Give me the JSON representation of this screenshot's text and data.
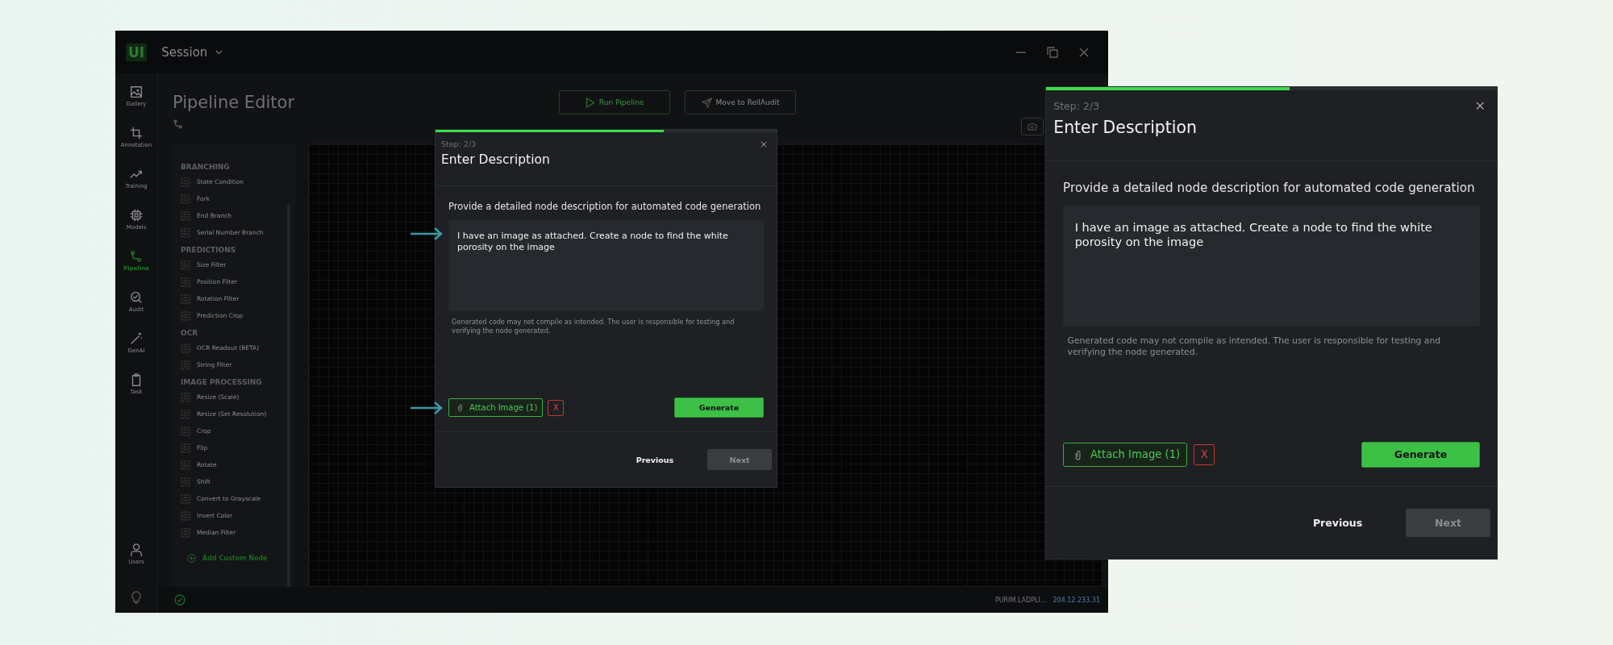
{
  "window": {
    "logo": "UI",
    "title": "Session"
  },
  "nav_rail": [
    {
      "label": "Gallery",
      "selected": false
    },
    {
      "label": "Annotation",
      "selected": false
    },
    {
      "label": "Training",
      "selected": false
    },
    {
      "label": "Models",
      "selected": false
    },
    {
      "label": "Pipeline",
      "selected": true
    },
    {
      "label": "Audit",
      "selected": false
    },
    {
      "label": "GenAI",
      "selected": false
    },
    {
      "label": "Task",
      "selected": false
    }
  ],
  "nav_bottom": {
    "label": "Users"
  },
  "page": {
    "title": "Pipeline Editor"
  },
  "toolbar": {
    "run_button": "Run Pipeline",
    "move_button": "Move to RellAudit"
  },
  "node_library": {
    "groups": [
      {
        "heading": "BRANCHING",
        "items": [
          "State Condition",
          "Fork",
          "End Branch",
          "Serial Number Branch"
        ]
      },
      {
        "heading": "PREDICTIONS",
        "items": [
          "Size Filter",
          "Position Filter",
          "Rotation Filter",
          "Prediction Crop"
        ]
      },
      {
        "heading": "OCR",
        "items": [
          "OCR Readout (BETA)",
          "String Filter"
        ]
      },
      {
        "heading": "IMAGE PROCESSING",
        "items": [
          "Resize (Scale)",
          "Resize (Set Resolution)",
          "Crop",
          "Flip",
          "Rotate",
          "Shift",
          "Convert to Grayscale",
          "Invert Color",
          "Median Filter"
        ]
      }
    ],
    "add_custom_node": "Add Custom Node"
  },
  "status_bar": {
    "user": "PURIM.LADPLI...",
    "ip": "204.12.233.31"
  },
  "dialogs": [
    {
      "step": "Step: 2/3",
      "level": 0.67,
      "title": "Enter Description",
      "prompt": "Provide a detailed node description for automated code generation",
      "description": "I have an image as attached. Create a node to find the white porosity on the image",
      "disclaimer": "Generated code may not compile as intended. The user is responsible for testing and verifying the node generated.",
      "attach_button": "Attach Image (1)",
      "remove_button": "X",
      "generate_button": "Generate",
      "previous_button": "Previous",
      "next_button": "Next",
      "next_disabled": true
    },
    {
      "step": "Step: 2/3",
      "level": 0.54,
      "title": "Enter Description",
      "prompt": "Provide a detailed node description for automated code generation",
      "description": "I have an image as attached. Create a node to find the white porosity on the image",
      "disclaimer": "Generated code may not compile as intended. The user is responsible for testing and verifying the node generated.",
      "attach_button": "Attach Image (1)",
      "remove_button": "X",
      "generate_button": "Generate",
      "previous_button": "Previous",
      "next_button": "Next",
      "next_disabled": true
    }
  ]
}
